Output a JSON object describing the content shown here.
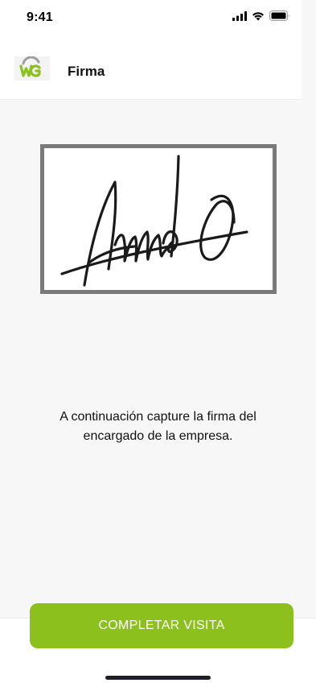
{
  "status_bar": {
    "time": "9:41",
    "icons": [
      "cellular-signal-icon",
      "wifi-icon",
      "battery-icon"
    ]
  },
  "header": {
    "title": "Firma",
    "logo_icon": "company-logo-icon",
    "brand_colors": [
      "#8cc11d",
      "#9e9e9e"
    ]
  },
  "signature_pad": {
    "has_signature": true,
    "border_color": "#7a7a7a"
  },
  "instructions": {
    "text": "A continuación capture la firma del encargado de la empresa."
  },
  "actions": {
    "complete_label": "COMPLETAR VISITA",
    "button_color": "#8cc11d"
  }
}
